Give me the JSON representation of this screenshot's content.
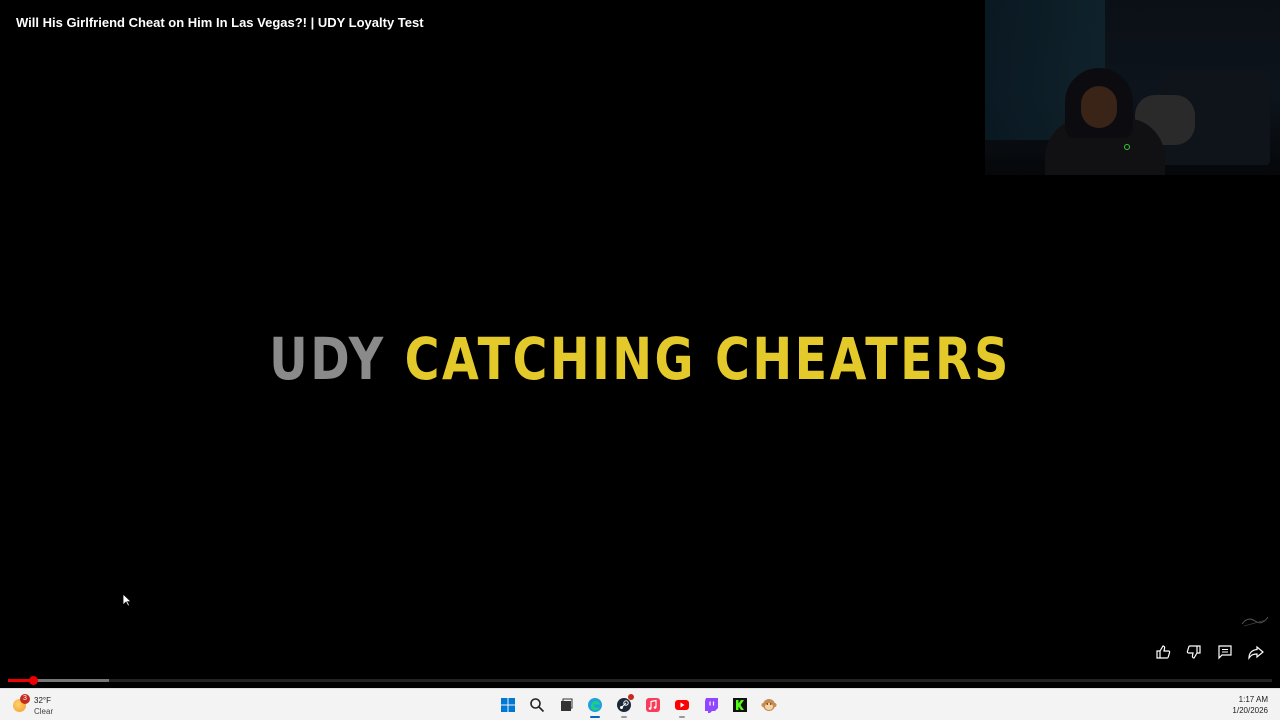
{
  "video": {
    "title": "Will His Girlfriend Cheat on Him In Las Vegas?! | UDY Loyalty Test",
    "card_word_1": "UDY",
    "card_word_2": "CATCHING CHEATERS",
    "progress_played_fraction": 0.02,
    "progress_buffered_fraction": 0.08
  },
  "actions": [
    {
      "name": "like-button",
      "icon": "thumbs-up-icon"
    },
    {
      "name": "dislike-button",
      "icon": "thumbs-down-icon"
    },
    {
      "name": "comments-button",
      "icon": "comment-icon"
    },
    {
      "name": "share-button",
      "icon": "share-icon"
    }
  ],
  "taskbar": {
    "weather": {
      "temp": "32°F",
      "condition": "Clear",
      "badge": "3"
    },
    "apps": [
      "start-icon",
      "search-icon",
      "file-explorer-icon",
      "edge-icon",
      "steam-icon",
      "apple-music-icon",
      "youtube-icon",
      "twitch-icon",
      "kick-icon",
      "monkey-app-icon"
    ],
    "clock": {
      "time": "1:17 AM",
      "date": "1/20/2026"
    }
  },
  "colors": {
    "accent_red": "#ee0000",
    "title_yellow": "#e3c92a",
    "title_grey": "#8a8a8a",
    "taskbar_bg": "#f3f3f3"
  }
}
